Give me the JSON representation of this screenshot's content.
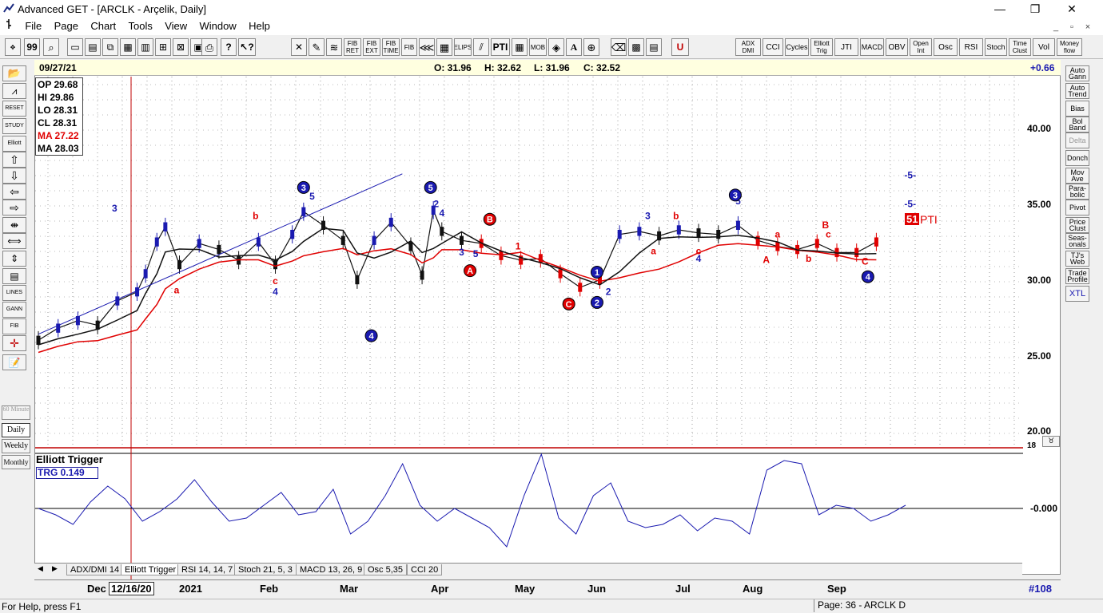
{
  "window": {
    "title": "Advanced GET - [ARCLK - Arçelik, Daily]",
    "minimize": "—",
    "maximize": "❐",
    "close": "✕"
  },
  "menu": [
    "File",
    "Page",
    "Chart",
    "Tools",
    "View",
    "Window",
    "Help"
  ],
  "toolbar_buttons": [
    "FIB RET",
    "FIB EXT",
    "FIB TIME",
    "FIB",
    "ELIPS",
    "PTI",
    "MOB",
    "A",
    "U"
  ],
  "indicator_buttons": [
    "ADX DMI",
    "CCI",
    "Cycles",
    "Elliott Trig",
    "JTI",
    "MACD",
    "OBV",
    "Open Int",
    "Osc",
    "RSI",
    "Stoch",
    "Time Clust",
    "Vol",
    "Money flow"
  ],
  "left_tools": [
    "RESET",
    "STUDY",
    "Elliott",
    "LINES",
    "GANN",
    "FIB"
  ],
  "right_tools": [
    "Auto Gann",
    "Auto Trend",
    "Bias",
    "Bol Band",
    "Delta",
    "Donch",
    "Mov Ave",
    "Para-bolic",
    "Pivot",
    "Price Clust",
    "Seas-onals",
    "TJ's Web",
    "Trade Profile",
    "XTL"
  ],
  "timeframes": [
    "60 Minute",
    "Daily",
    "Weekly",
    "Monthly"
  ],
  "info": {
    "date": "09/27/21",
    "open": "O: 31.96",
    "high": "H: 32.62",
    "low": "L: 31.96",
    "close": "C: 32.52",
    "change": "+0.66"
  },
  "ohlc_box": {
    "op": "OP 29.68",
    "hi": "HI  29.86",
    "lo": "LO 28.31",
    "cl": "CL  28.31",
    "ma1": "MA 27.22",
    "ma2": "MA 28.03"
  },
  "price_axis": [
    "40.00",
    "35.00",
    "30.00",
    "25.00",
    "20.00",
    "18"
  ],
  "osc_axis": "0.000",
  "osc_label": "Elliott Trigger",
  "trg_value": "TRG 0.149",
  "pti_label": "51",
  "pti_text": "PTI",
  "tabs": [
    "ADX/DMI 14",
    "Elliott Trigger",
    "RSI 14, 14, 7",
    "Stoch 21, 5, 3",
    "MACD 13, 26, 9",
    "Osc 5,35",
    "CCI 20"
  ],
  "dates": [
    "Dec",
    "12/16/20",
    "2021",
    "Feb",
    "Mar",
    "Apr",
    "May",
    "Jun",
    "Jul",
    "Aug",
    "Sep"
  ],
  "bar_count": "#108",
  "status": "For Help, press F1",
  "page": "Page: 36 - ARCLK D",
  "wave_labels": [
    {
      "t": "3",
      "c": "blue",
      "date": "2020-12-28",
      "v": 34.5
    },
    {
      "t": "a",
      "c": "red",
      "date": "2021-01-19",
      "v": 29.1
    },
    {
      "t": "b",
      "c": "red",
      "date": "2021-02-16",
      "v": 34.0
    },
    {
      "t": "c",
      "c": "red",
      "date": "2021-02-23",
      "v": 29.7
    },
    {
      "t": "4",
      "c": "blue",
      "date": "2021-02-23",
      "v": 29.0
    },
    {
      "t": "5",
      "c": "blue",
      "date": "2021-03-08",
      "v": 35.3
    },
    {
      "t": "3",
      "c": "blue",
      "date": "2021-04-30",
      "v": 31.6
    },
    {
      "t": "5",
      "c": "blue",
      "date": "2021-05-05",
      "v": 31.5
    },
    {
      "t": "4",
      "c": "blue",
      "date": "2021-04-23",
      "v": 34.2
    },
    {
      "t": "2",
      "c": "blue",
      "date": "2021-04-21",
      "v": 34.8
    },
    {
      "t": "1",
      "c": "red",
      "date": "2021-05-20",
      "v": 32.0
    },
    {
      "t": "2",
      "c": "blue",
      "date": "2021-06-21",
      "v": 29.0
    },
    {
      "t": "3",
      "c": "blue",
      "date": "2021-07-05",
      "v": 34.0
    },
    {
      "t": "a",
      "c": "red",
      "date": "2021-07-07",
      "v": 31.7
    },
    {
      "t": "b",
      "c": "red",
      "date": "2021-07-15",
      "v": 34.0
    },
    {
      "t": "5",
      "c": "blue",
      "date": "2021-08-06",
      "v": 35.0
    },
    {
      "t": "c",
      "c": "red",
      "date": "2021-07-23",
      "v": 31.7
    },
    {
      "t": "4",
      "c": "blue",
      "date": "2021-07-23",
      "v": 31.2
    },
    {
      "t": "A",
      "c": "red",
      "date": "2021-08-16",
      "v": 31.1
    },
    {
      "t": "a",
      "c": "red",
      "date": "2021-08-20",
      "v": 32.8
    },
    {
      "t": "b",
      "c": "red",
      "date": "2021-08-31",
      "v": 31.2
    },
    {
      "t": "B",
      "c": "red",
      "date": "2021-09-06",
      "v": 33.4
    },
    {
      "t": "c",
      "c": "red",
      "date": "2021-09-07",
      "v": 32.8
    },
    {
      "t": "C",
      "c": "red",
      "date": "2021-09-20",
      "v": 31.0
    },
    {
      "t": "-5-",
      "c": "blue",
      "date": "2021-10-06",
      "v": 36.7
    },
    {
      "t": "-5-",
      "c": "blue",
      "date": "2021-10-06",
      "v": 34.8
    }
  ],
  "wave_circles": [
    {
      "t": "3",
      "c": "blue",
      "date": "2021-03-05",
      "v": 36.1
    },
    {
      "t": "4",
      "c": "blue",
      "date": "2021-03-29",
      "v": 26.3
    },
    {
      "t": "5",
      "c": "blue",
      "date": "2021-04-19",
      "v": 36.1
    },
    {
      "t": "B",
      "c": "red",
      "date": "2021-05-10",
      "v": 34.0
    },
    {
      "t": "A",
      "c": "red",
      "date": "2021-05-03",
      "v": 30.6
    },
    {
      "t": "C",
      "c": "red",
      "date": "2021-06-07",
      "v": 28.4
    },
    {
      "t": "1",
      "c": "blue",
      "date": "2021-06-17",
      "v": 30.5
    },
    {
      "t": "2",
      "c": "blue",
      "date": "2021-06-17",
      "v": 28.5
    },
    {
      "t": "3",
      "c": "blue",
      "date": "2021-08-05",
      "v": 35.6
    },
    {
      "t": "4",
      "c": "blue",
      "date": "2021-09-21",
      "v": 30.2
    }
  ]
}
